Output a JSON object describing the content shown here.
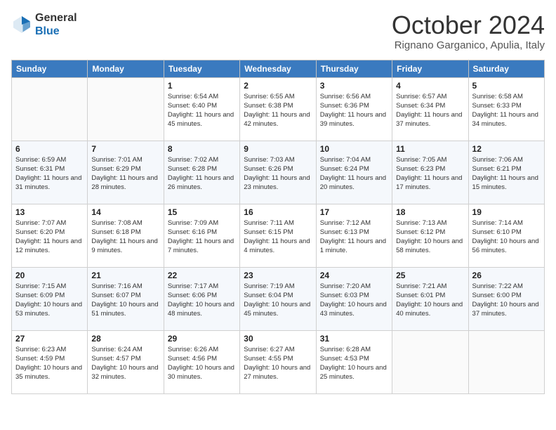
{
  "header": {
    "logo_line1": "General",
    "logo_line2": "Blue",
    "month": "October 2024",
    "location": "Rignano Garganico, Apulia, Italy"
  },
  "weekdays": [
    "Sunday",
    "Monday",
    "Tuesday",
    "Wednesday",
    "Thursday",
    "Friday",
    "Saturday"
  ],
  "weeks": [
    [
      {
        "day": "",
        "sunrise": "",
        "sunset": "",
        "daylight": ""
      },
      {
        "day": "",
        "sunrise": "",
        "sunset": "",
        "daylight": ""
      },
      {
        "day": "1",
        "sunrise": "Sunrise: 6:54 AM",
        "sunset": "Sunset: 6:40 PM",
        "daylight": "Daylight: 11 hours and 45 minutes."
      },
      {
        "day": "2",
        "sunrise": "Sunrise: 6:55 AM",
        "sunset": "Sunset: 6:38 PM",
        "daylight": "Daylight: 11 hours and 42 minutes."
      },
      {
        "day": "3",
        "sunrise": "Sunrise: 6:56 AM",
        "sunset": "Sunset: 6:36 PM",
        "daylight": "Daylight: 11 hours and 39 minutes."
      },
      {
        "day": "4",
        "sunrise": "Sunrise: 6:57 AM",
        "sunset": "Sunset: 6:34 PM",
        "daylight": "Daylight: 11 hours and 37 minutes."
      },
      {
        "day": "5",
        "sunrise": "Sunrise: 6:58 AM",
        "sunset": "Sunset: 6:33 PM",
        "daylight": "Daylight: 11 hours and 34 minutes."
      }
    ],
    [
      {
        "day": "6",
        "sunrise": "Sunrise: 6:59 AM",
        "sunset": "Sunset: 6:31 PM",
        "daylight": "Daylight: 11 hours and 31 minutes."
      },
      {
        "day": "7",
        "sunrise": "Sunrise: 7:01 AM",
        "sunset": "Sunset: 6:29 PM",
        "daylight": "Daylight: 11 hours and 28 minutes."
      },
      {
        "day": "8",
        "sunrise": "Sunrise: 7:02 AM",
        "sunset": "Sunset: 6:28 PM",
        "daylight": "Daylight: 11 hours and 26 minutes."
      },
      {
        "day": "9",
        "sunrise": "Sunrise: 7:03 AM",
        "sunset": "Sunset: 6:26 PM",
        "daylight": "Daylight: 11 hours and 23 minutes."
      },
      {
        "day": "10",
        "sunrise": "Sunrise: 7:04 AM",
        "sunset": "Sunset: 6:24 PM",
        "daylight": "Daylight: 11 hours and 20 minutes."
      },
      {
        "day": "11",
        "sunrise": "Sunrise: 7:05 AM",
        "sunset": "Sunset: 6:23 PM",
        "daylight": "Daylight: 11 hours and 17 minutes."
      },
      {
        "day": "12",
        "sunrise": "Sunrise: 7:06 AM",
        "sunset": "Sunset: 6:21 PM",
        "daylight": "Daylight: 11 hours and 15 minutes."
      }
    ],
    [
      {
        "day": "13",
        "sunrise": "Sunrise: 7:07 AM",
        "sunset": "Sunset: 6:20 PM",
        "daylight": "Daylight: 11 hours and 12 minutes."
      },
      {
        "day": "14",
        "sunrise": "Sunrise: 7:08 AM",
        "sunset": "Sunset: 6:18 PM",
        "daylight": "Daylight: 11 hours and 9 minutes."
      },
      {
        "day": "15",
        "sunrise": "Sunrise: 7:09 AM",
        "sunset": "Sunset: 6:16 PM",
        "daylight": "Daylight: 11 hours and 7 minutes."
      },
      {
        "day": "16",
        "sunrise": "Sunrise: 7:11 AM",
        "sunset": "Sunset: 6:15 PM",
        "daylight": "Daylight: 11 hours and 4 minutes."
      },
      {
        "day": "17",
        "sunrise": "Sunrise: 7:12 AM",
        "sunset": "Sunset: 6:13 PM",
        "daylight": "Daylight: 11 hours and 1 minute."
      },
      {
        "day": "18",
        "sunrise": "Sunrise: 7:13 AM",
        "sunset": "Sunset: 6:12 PM",
        "daylight": "Daylight: 10 hours and 58 minutes."
      },
      {
        "day": "19",
        "sunrise": "Sunrise: 7:14 AM",
        "sunset": "Sunset: 6:10 PM",
        "daylight": "Daylight: 10 hours and 56 minutes."
      }
    ],
    [
      {
        "day": "20",
        "sunrise": "Sunrise: 7:15 AM",
        "sunset": "Sunset: 6:09 PM",
        "daylight": "Daylight: 10 hours and 53 minutes."
      },
      {
        "day": "21",
        "sunrise": "Sunrise: 7:16 AM",
        "sunset": "Sunset: 6:07 PM",
        "daylight": "Daylight: 10 hours and 51 minutes."
      },
      {
        "day": "22",
        "sunrise": "Sunrise: 7:17 AM",
        "sunset": "Sunset: 6:06 PM",
        "daylight": "Daylight: 10 hours and 48 minutes."
      },
      {
        "day": "23",
        "sunrise": "Sunrise: 7:19 AM",
        "sunset": "Sunset: 6:04 PM",
        "daylight": "Daylight: 10 hours and 45 minutes."
      },
      {
        "day": "24",
        "sunrise": "Sunrise: 7:20 AM",
        "sunset": "Sunset: 6:03 PM",
        "daylight": "Daylight: 10 hours and 43 minutes."
      },
      {
        "day": "25",
        "sunrise": "Sunrise: 7:21 AM",
        "sunset": "Sunset: 6:01 PM",
        "daylight": "Daylight: 10 hours and 40 minutes."
      },
      {
        "day": "26",
        "sunrise": "Sunrise: 7:22 AM",
        "sunset": "Sunset: 6:00 PM",
        "daylight": "Daylight: 10 hours and 37 minutes."
      }
    ],
    [
      {
        "day": "27",
        "sunrise": "Sunrise: 6:23 AM",
        "sunset": "Sunset: 4:59 PM",
        "daylight": "Daylight: 10 hours and 35 minutes."
      },
      {
        "day": "28",
        "sunrise": "Sunrise: 6:24 AM",
        "sunset": "Sunset: 4:57 PM",
        "daylight": "Daylight: 10 hours and 32 minutes."
      },
      {
        "day": "29",
        "sunrise": "Sunrise: 6:26 AM",
        "sunset": "Sunset: 4:56 PM",
        "daylight": "Daylight: 10 hours and 30 minutes."
      },
      {
        "day": "30",
        "sunrise": "Sunrise: 6:27 AM",
        "sunset": "Sunset: 4:55 PM",
        "daylight": "Daylight: 10 hours and 27 minutes."
      },
      {
        "day": "31",
        "sunrise": "Sunrise: 6:28 AM",
        "sunset": "Sunset: 4:53 PM",
        "daylight": "Daylight: 10 hours and 25 minutes."
      },
      {
        "day": "",
        "sunrise": "",
        "sunset": "",
        "daylight": ""
      },
      {
        "day": "",
        "sunrise": "",
        "sunset": "",
        "daylight": ""
      }
    ]
  ]
}
